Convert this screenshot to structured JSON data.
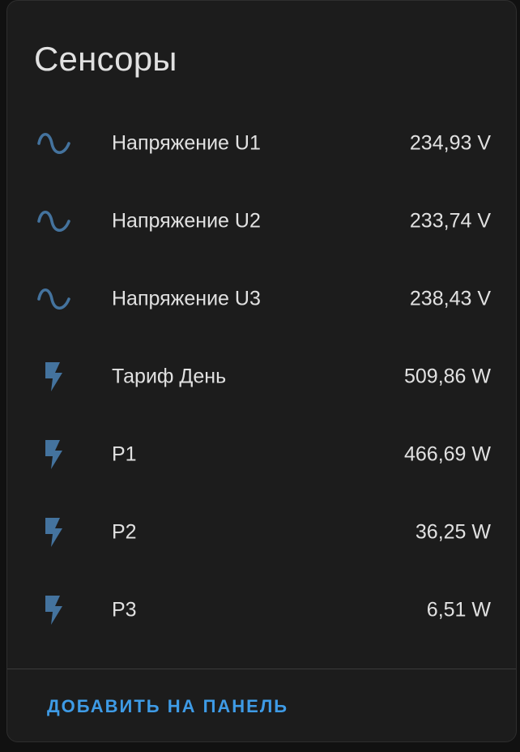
{
  "card": {
    "title": "Сенсоры",
    "action_label": "ДОБАВИТЬ НА ПАНЕЛЬ"
  },
  "colors": {
    "background": "#111111",
    "card": "#1c1c1c",
    "text": "#e1e1e1",
    "icon": "#44739e",
    "accent": "#3e9be6"
  },
  "sensors": [
    {
      "icon": "sine-wave-icon",
      "name": "Напряжение U1",
      "value": "234,93 V"
    },
    {
      "icon": "sine-wave-icon",
      "name": "Напряжение U2",
      "value": "233,74 V"
    },
    {
      "icon": "sine-wave-icon",
      "name": "Напряжение U3",
      "value": "238,43 V"
    },
    {
      "icon": "flash-icon",
      "name": "Тариф День",
      "value": "509,86 W"
    },
    {
      "icon": "flash-icon",
      "name": "P1",
      "value": "466,69 W"
    },
    {
      "icon": "flash-icon",
      "name": "P2",
      "value": "36,25 W"
    },
    {
      "icon": "flash-icon",
      "name": "P3",
      "value": "6,51 W"
    }
  ]
}
